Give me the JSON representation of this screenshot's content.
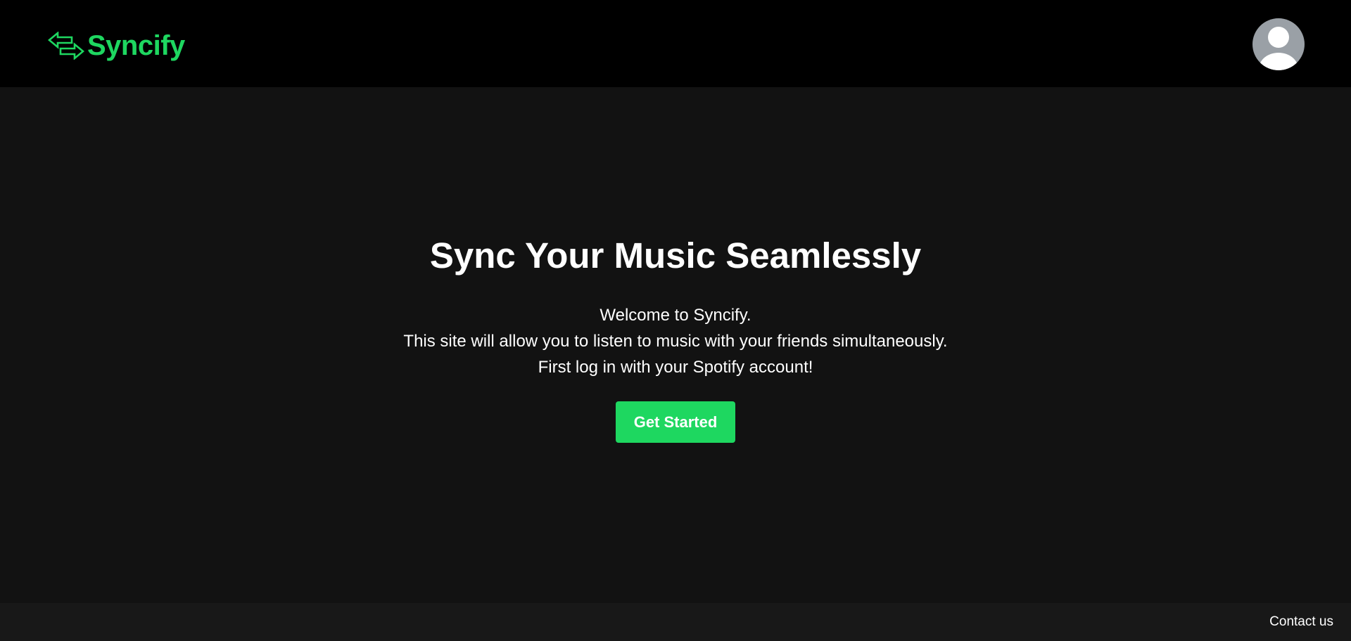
{
  "header": {
    "brand_name": "Syncify",
    "brand_icon": "sync-arrows-icon",
    "avatar_icon": "user-avatar-icon"
  },
  "hero": {
    "title": "Sync Your Music Seamlessly",
    "lines": [
      "Welcome to Syncify.",
      "This site will allow you to listen to music with your friends simultaneously.",
      "First log in with your Spotify account!"
    ],
    "cta_label": "Get Started"
  },
  "footer": {
    "contact_label": "Contact us"
  },
  "colors": {
    "accent": "#1ed760",
    "header_bg": "#000000",
    "page_bg": "#121212",
    "footer_bg": "#181818",
    "avatar_bg": "#9aa0a6"
  }
}
